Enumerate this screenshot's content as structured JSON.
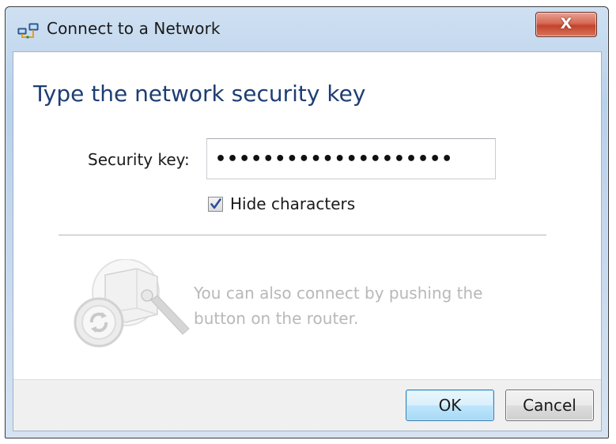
{
  "window": {
    "title": "Connect to a Network",
    "close_label": "X"
  },
  "main": {
    "heading": "Type the network security key",
    "security_key_label": "Security key:",
    "security_key_value": "••••••••••••••••••••",
    "hide_characters_label": "Hide characters",
    "hide_characters_checked": true,
    "wps_text_line1": "You can also connect by pushing the",
    "wps_text_line2": "button on the router."
  },
  "footer": {
    "ok_label": "OK",
    "cancel_label": "Cancel"
  },
  "colors": {
    "heading": "#1e3e73",
    "muted_text": "#b8b8b8",
    "close_button": "#c3432c",
    "default_button_border": "#3c7fb1"
  },
  "icons": {
    "title": "network-icon",
    "close": "close-icon",
    "checkbox": "checkmark-icon",
    "illustration": "wps-router-icon"
  }
}
